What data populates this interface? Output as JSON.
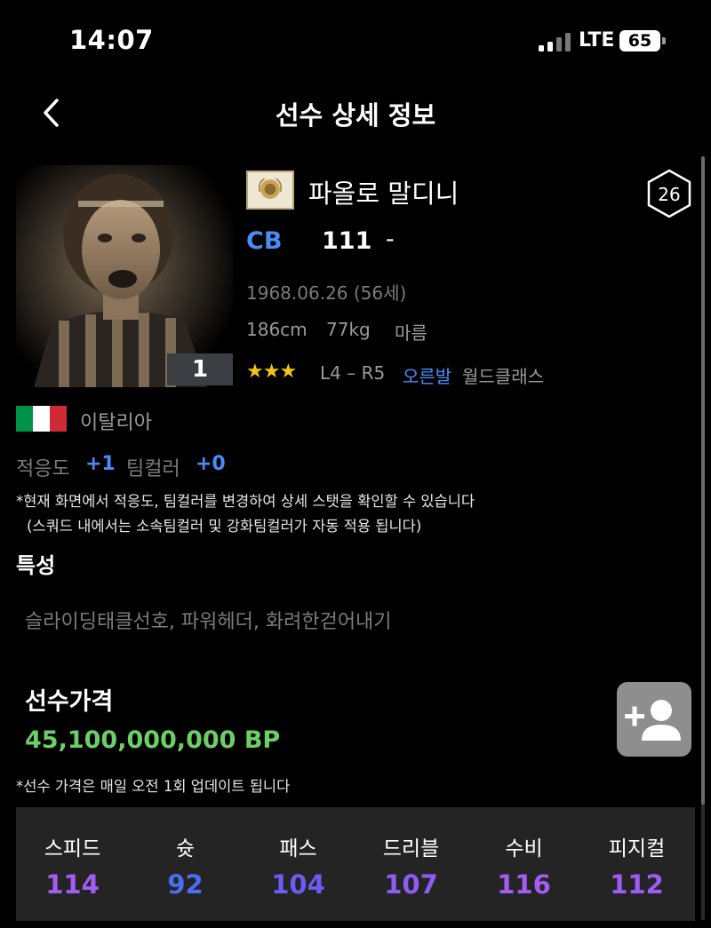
{
  "status_bar": {
    "time": "14:07",
    "network": "LTE",
    "battery": "65"
  },
  "header": {
    "title": "선수 상세 정보"
  },
  "player": {
    "jersey_number": "1",
    "name": "파올로 말디니",
    "level": "26",
    "position": "CB",
    "position_color": "#4a8cf6",
    "overall": "111",
    "dash": "-",
    "birth": "1968.06.26 (56세)",
    "height": "186cm",
    "weight": "77kg",
    "body_type": "마름",
    "stars": "★★★",
    "skill": "L4 – R5",
    "foot": "오른발",
    "grade": "월드클래스"
  },
  "nation": {
    "name": "이탈리아",
    "flag_colors": [
      "#009246",
      "#ffffff",
      "#ce2b37"
    ]
  },
  "modifiers": {
    "adapt_label": "적응도",
    "adapt_value": "+1",
    "team_label": "팀컬러",
    "team_value": "+0"
  },
  "notes": {
    "line1": "*현재 화면에서 적응도, 팀컬러를 변경하여 상세 스탯을 확인할 수 있습니다",
    "line2": "(스쿼드 내에서는 소속팀컬러 및 강화팀컬러가 자동 적용 됩니다)"
  },
  "traits": {
    "title": "특성",
    "list": "슬라이딩태클선호, 파워헤더, 화려한걷어내기"
  },
  "price": {
    "title": "선수가격",
    "value": "45,100,000,000 BP",
    "color": "#6ccf65",
    "note": "*선수 가격은 매일 오전 1회 업데이트 됩니다"
  },
  "add_button": {
    "icon": "add-person-icon"
  },
  "stats": [
    {
      "label": "스피드",
      "value": "114",
      "color": "#a35cf5"
    },
    {
      "label": "슛",
      "value": "92",
      "color": "#4a6ef2"
    },
    {
      "label": "패스",
      "value": "104",
      "color": "#6b5cf5"
    },
    {
      "label": "드리블",
      "value": "107",
      "color": "#8c5cf5"
    },
    {
      "label": "수비",
      "value": "116",
      "color": "#a35cf5"
    },
    {
      "label": "피지컬",
      "value": "112",
      "color": "#9c5cf5"
    }
  ]
}
